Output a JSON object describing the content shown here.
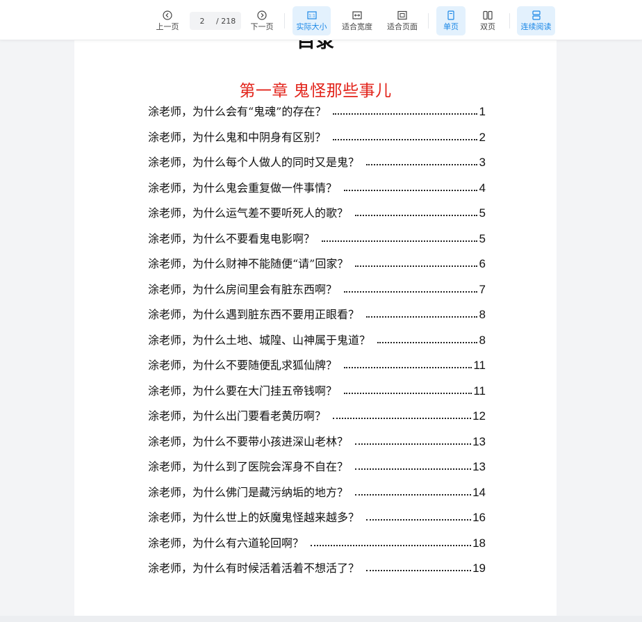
{
  "toolbar": {
    "prev_label": "上一页",
    "next_label": "下一页",
    "current_page": "2",
    "total_pages": "/ 218",
    "actual_size_label": "实际大小",
    "fit_width_label": "适合宽度",
    "fit_page_label": "适合页面",
    "single_page_label": "单页",
    "double_page_label": "双页",
    "continuous_label": "连续阅读",
    "accent_color": "#1a87e6",
    "active_bg_color": "#e3f1fd"
  },
  "document": {
    "cut_title": "目录",
    "chapter_title": "第一章  鬼怪那些事儿",
    "title_color": "#e2231a",
    "toc": [
      {
        "question": "涂老师，为什么会有“鬼魂”的存在？",
        "page": "1"
      },
      {
        "question": "涂老师，为什么鬼和中阴身有区别？",
        "page": "2"
      },
      {
        "question": "涂老师，为什么每个人做人的同时又是鬼？",
        "page": "3"
      },
      {
        "question": "涂老师，为什么鬼会重复做一件事情？",
        "page": "4"
      },
      {
        "question": "涂老师，为什么运气差不要听死人的歌？",
        "page": "5"
      },
      {
        "question": "涂老师，为什么不要看鬼电影啊？",
        "page": "5"
      },
      {
        "question": "涂老师，为什么财神不能随便“请”回家？",
        "page": "6"
      },
      {
        "question": "涂老师，为什么房间里会有脏东西啊？",
        "page": "7"
      },
      {
        "question": "涂老师，为什么遇到脏东西不要用正眼看？",
        "page": "8"
      },
      {
        "question": "涂老师，为什么土地、城隍、山神属于鬼道？",
        "page": "8"
      },
      {
        "question": "涂老师，为什么不要随便乱求狐仙牌？",
        "page": "11"
      },
      {
        "question": "涂老师，为什么要在大门挂五帝钱啊？",
        "page": "11"
      },
      {
        "question": "涂老师，为什么出门要看老黄历啊？",
        "page": "12"
      },
      {
        "question": "涂老师，为什么不要带小孩进深山老林？",
        "page": "13"
      },
      {
        "question": "涂老师，为什么到了医院会浑身不自在？",
        "page": "13"
      },
      {
        "question": "涂老师，为什么佛门是藏污纳垢的地方？",
        "page": "14"
      },
      {
        "question": "涂老师，为什么世上的妖魔鬼怪越来越多？",
        "page": "16"
      },
      {
        "question": "涂老师，为什么有六道轮回啊？",
        "page": "18"
      },
      {
        "question": "涂老师，为什么有时候活着活着不想活了？",
        "page": "19"
      }
    ]
  }
}
